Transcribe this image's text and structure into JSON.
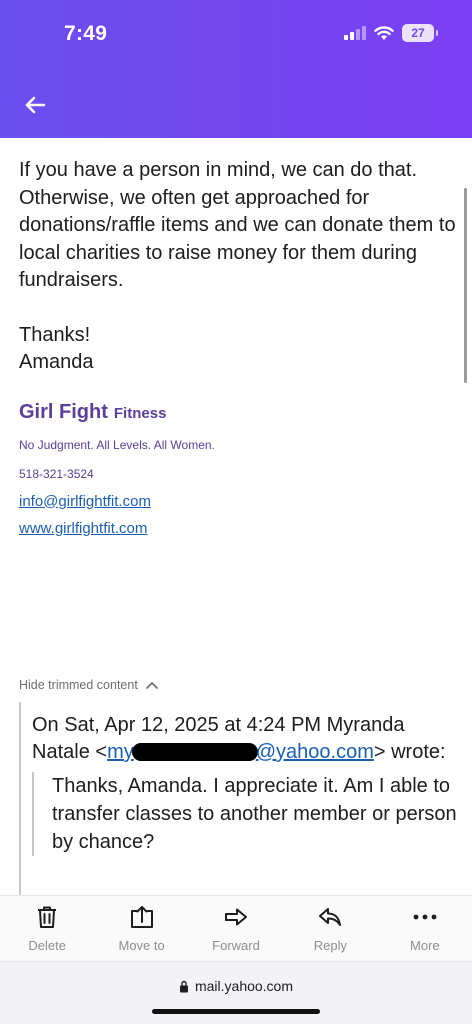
{
  "status_bar": {
    "time": "7:49",
    "battery": "27"
  },
  "header": {
    "back_icon": "arrow-left-icon"
  },
  "email": {
    "paragraph": "If you have a person in mind, we can do that. Otherwise, we often get approached for donations/raffle items and we can donate them to local charities to raise money for them during fundraisers.",
    "thanks": "Thanks!",
    "sender": "Amanda",
    "signature": {
      "brand_name": "Girl Fight",
      "brand_sub": "Fitness",
      "tagline": "No Judgment. All Levels. All Women.",
      "phone": "518-321-3524",
      "email": "info@girlfightfit.com",
      "website": "www.girlfightfit.com"
    }
  },
  "trimmed": {
    "label": "Hide trimmed content",
    "icon": "chevron-up-icon"
  },
  "quoted": {
    "header_line": "On Sat, Apr 12, 2025 at 4:24 PM Myranda Natale <",
    "email_visible_start": "my",
    "email_visible_end": "@yahoo.com",
    "header_end": "> wrote:",
    "message": "Thanks, Amanda. I appreciate it. Am I able to transfer classes to another member or person by chance?"
  },
  "toolbar": {
    "delete": "Delete",
    "move_to": "Move to",
    "forward": "Forward",
    "reply": "Reply",
    "more": "More"
  },
  "browser": {
    "url": "mail.yahoo.com"
  },
  "colors": {
    "header_gradient_start": "#6a4ff0",
    "header_gradient_end": "#7c3ff2",
    "brand_purple": "#5b3e9a",
    "link_blue": "#1a5fb4"
  }
}
